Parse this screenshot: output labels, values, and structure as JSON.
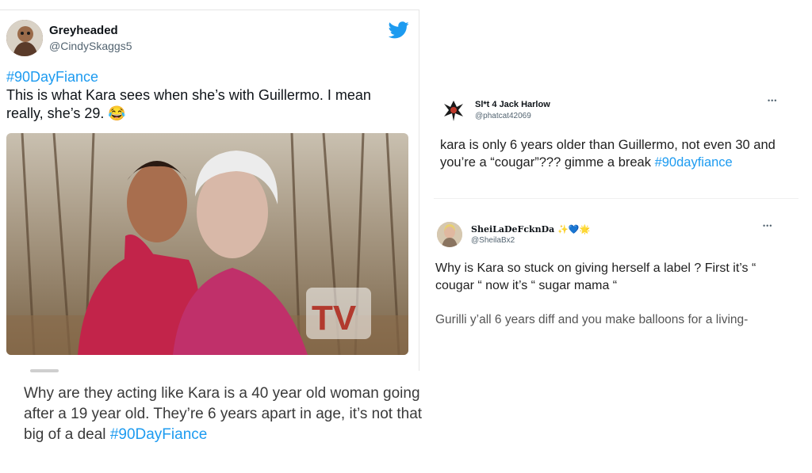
{
  "tweet1": {
    "display_name": "Greyheaded",
    "handle": "@CindySkaggs5",
    "hashtag": "#90DayFiance",
    "text": "This is what Kara sees when she’s with Guillermo. I mean really, she’s 29.",
    "emoji": "😂",
    "watermark": "TV"
  },
  "tweet2": {
    "text": "Why are they acting like Kara is a 40 year old woman going after a 19 year old. They’re 6 years apart in age, it’s not that big of a deal ",
    "hashtag": "#90DayFiance"
  },
  "tweet3": {
    "display_name": "Sl*t 4 Jack Harlow",
    "handle": "@phatcat42069",
    "more": "•••",
    "text": "kara is only 6 years older than  Guillermo, not even 30 and you’re a “cougar”??? gimme a break ",
    "hashtag": "#90dayfiance"
  },
  "tweet4": {
    "display_name": "SheiLaDeFcknDa",
    "name_emojis": "✨💙🌟",
    "handle": "@SheilaBx2",
    "more": "•••",
    "text1": "Why is Kara so stuck on giving herself a label ? First it’s “ cougar “ now it’s “ sugar mama “",
    "text2": "Gurilli y’all 6 years diff and you make balloons for a living-"
  },
  "colors": {
    "link": "#1d9bf0",
    "twitter_blue": "#1d9bf0"
  },
  "icons": [
    "twitter-bird-icon",
    "more-icon"
  ]
}
